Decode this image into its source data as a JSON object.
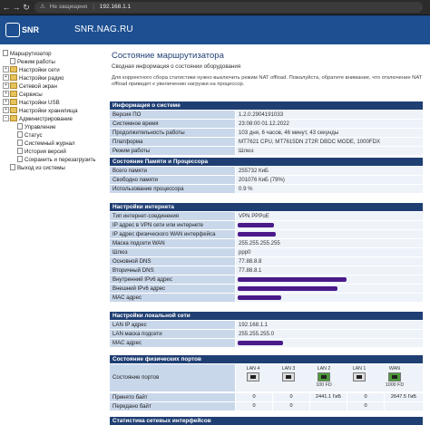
{
  "browser": {
    "security_label": "Не защищено",
    "url": "192.168.1.1"
  },
  "header": {
    "logo_text": "SNR",
    "site_name": "SNR.NAG.RU"
  },
  "sidebar": {
    "items": [
      {
        "label": "Маршрутизатор",
        "type": "root"
      },
      {
        "label": "Режим работы",
        "type": "page"
      },
      {
        "label": "Настройки сети",
        "type": "folder"
      },
      {
        "label": "Настройки радио",
        "type": "folder"
      },
      {
        "label": "Сетевой экран",
        "type": "folder"
      },
      {
        "label": "Сервисы",
        "type": "folder"
      },
      {
        "label": "Настройки USB",
        "type": "folder"
      },
      {
        "label": "Настройки хранилища",
        "type": "folder"
      },
      {
        "label": "Администрирование",
        "type": "folder-open"
      },
      {
        "label": "Управление",
        "type": "child"
      },
      {
        "label": "Статус",
        "type": "child"
      },
      {
        "label": "Системный журнал",
        "type": "child"
      },
      {
        "label": "История версий",
        "type": "child"
      },
      {
        "label": "Сохранить и перезагрузить",
        "type": "child"
      },
      {
        "label": "Выход из системы",
        "type": "page"
      }
    ]
  },
  "main": {
    "title": "Состояние маршрутизатора",
    "subtitle": "Сводная информация о состоянии оборудования",
    "notice": "Для корректного сбора статистики нужно выключить режим NAT offload. Пожалуйста, обратите внимание, что отключение NAT offload приведет к увеличению нагрузки на процессор."
  },
  "system": {
    "header": "Информация о системе",
    "rows": [
      {
        "k": "Версия ПО",
        "v": "1.2.0.2904191033"
      },
      {
        "k": "Системное время",
        "v": "23:08:00 01.12.2022"
      },
      {
        "k": "Продолжительность работы",
        "v": "103 дня, 6 часов, 46 минут, 43 секунды"
      },
      {
        "k": "Платформа",
        "v": "MT7621 CPU, MT7615DN 2T2R DBDC MODE, 1000FDX"
      },
      {
        "k": "Режим работы",
        "v": "Шлюз"
      }
    ]
  },
  "memory": {
    "header": "Состояние Памяти и Процессора",
    "rows": [
      {
        "k": "Всего памяти",
        "v": "255732 КиБ"
      },
      {
        "k": "Свободно памяти",
        "v": "201076 КиБ (79%)"
      },
      {
        "k": "Использование процессора",
        "v": "0.9 %"
      }
    ]
  },
  "internet": {
    "header": "Настройки интернета",
    "rows": [
      {
        "k": "Тип интернет-соединения",
        "v": "VPN PPPoE"
      },
      {
        "k": "IP адрес в VPN сети или интернете",
        "v": ""
      },
      {
        "k": "IP адрес физического WAN интерфейса",
        "v": ""
      },
      {
        "k": "Маска подсети WAN",
        "v": "255.255.255.255"
      },
      {
        "k": "Шлюз",
        "v": "ppp0"
      },
      {
        "k": "Основной DNS",
        "v": "77.88.8.8"
      },
      {
        "k": "Вторичный DNS",
        "v": "77.88.8.1"
      },
      {
        "k": "Внутренний IPv6 адрес",
        "v": ""
      },
      {
        "k": "Внешний IPv6 адрес",
        "v": ""
      },
      {
        "k": "MAC адрес",
        "v": ""
      }
    ]
  },
  "lan": {
    "header": "Настройки локальной сети",
    "rows": [
      {
        "k": "LAN IP адрес",
        "v": "192.168.1.1"
      },
      {
        "k": "LAN маска подсети",
        "v": "255.255.255.0"
      },
      {
        "k": "MAC адрес",
        "v": ""
      }
    ]
  },
  "ports": {
    "header": "Состояние физических портов",
    "label": "Состояние портов",
    "items": [
      {
        "name": "LAN 4",
        "speed": "",
        "active": false
      },
      {
        "name": "LAN 3",
        "speed": "",
        "active": false
      },
      {
        "name": "LAN 2",
        "speed": "100 FD",
        "active": true
      },
      {
        "name": "LAN 1",
        "speed": "",
        "active": false
      },
      {
        "name": "WAN",
        "speed": "1000 FD",
        "active": true
      }
    ],
    "received_label": "Принято байт",
    "sent_label": "Передано байт",
    "received": [
      "0",
      "0",
      "2441.1 ГиБ",
      "0",
      "2647.5 ГиБ"
    ],
    "sent": [
      "0",
      "0",
      "",
      "0",
      ""
    ]
  },
  "footer_section": {
    "header": "Статистика сетевых интерфейсов"
  }
}
